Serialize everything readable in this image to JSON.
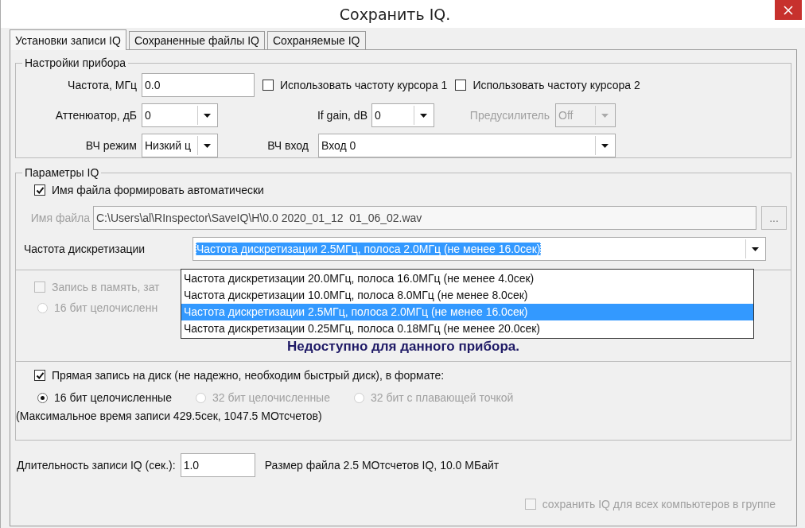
{
  "window": {
    "title": "Сохранить IQ."
  },
  "tabs": [
    {
      "label": "Установки записи IQ",
      "selected": true
    },
    {
      "label": "Сохраненные файлы IQ",
      "selected": false
    },
    {
      "label": "Сохраняемые IQ",
      "selected": false
    }
  ],
  "device": {
    "title": "Настройки прибора",
    "frequency": {
      "label": "Частота, МГц",
      "value": "0.0"
    },
    "cursor_checkboxes": [
      {
        "label": "Использовать частоту курсора 1",
        "checked": false
      },
      {
        "label": "Использовать частоту курсора 2",
        "checked": false
      }
    ],
    "attenuator": {
      "label": "Аттенюатор, дБ",
      "value": "0"
    },
    "if_gain": {
      "label": "If gain, dB",
      "value": "0"
    },
    "preamp": {
      "label": "Предусилитель",
      "value": "Off",
      "disabled": true
    },
    "rf_mode": {
      "label": "ВЧ режим",
      "value": "Низкий ц"
    },
    "rf_input": {
      "label": "ВЧ вход",
      "value": "Вход 0"
    }
  },
  "iq": {
    "title": "Параметры IQ",
    "auto_filename": {
      "label": "Имя файла формировать автоматически",
      "checked": true
    },
    "filename": {
      "label": "Имя файла",
      "value": "C:\\Users\\al\\RInspector\\SaveIQ\\H\\0.0 2020_01_12  01_06_02.wav",
      "disabled": true
    },
    "browse_button": "...",
    "sample_rate": {
      "label": "Частота дискретизации",
      "value": "Частота дискретизации 2.5МГц, полоса 2.0МГц (не менее 16.0сек)",
      "expanded": true,
      "options": [
        {
          "label": "Частота дискретизации 20.0МГц, полоса 16.0МГц (не менее 4.0сек)",
          "selected": false
        },
        {
          "label": "Частота дискретизации 10.0МГц, полоса 8.0МГц (не менее 8.0сек)",
          "selected": false
        },
        {
          "label": "Частота дискретизации 2.5МГц, полоса 2.0МГц (не менее 16.0сек)",
          "selected": true
        },
        {
          "label": "Частота дискретизации 0.25МГц, полоса 0.18МГц (не менее 20.0сек)",
          "selected": false
        }
      ]
    }
  },
  "memory": {
    "checkbox": {
      "label": "Запись в память, зат",
      "checked": false,
      "disabled": true
    },
    "radio": {
      "label": "16 бит целочисленн",
      "selected": false,
      "disabled": true
    },
    "notice": "Недоступно для данного прибора."
  },
  "disk": {
    "checkbox": {
      "label": "Прямая запись на диск (не надежно, необходим быстрый диск), в формате:",
      "checked": true
    },
    "formats": [
      {
        "label": "16 бит целочисленные",
        "selected": true,
        "disabled": false
      },
      {
        "label": "32 бит целочисленные",
        "selected": false,
        "disabled": true
      },
      {
        "label": "32 бит с плавающей точкой",
        "selected": false,
        "disabled": true
      }
    ],
    "max_time": "(Максимальное время записи 429.5сек, 1047.5 МОтсчетов)"
  },
  "duration": {
    "label": "Длительность записи IQ (сек.):",
    "value": "1.0"
  },
  "file_size": "Размер файла 2.5 МОтсчетов IQ, 10.0 МБайт",
  "share_checkbox": {
    "label": "сохранить IQ для всех компьютеров в группе",
    "checked": false,
    "disabled": true
  }
}
